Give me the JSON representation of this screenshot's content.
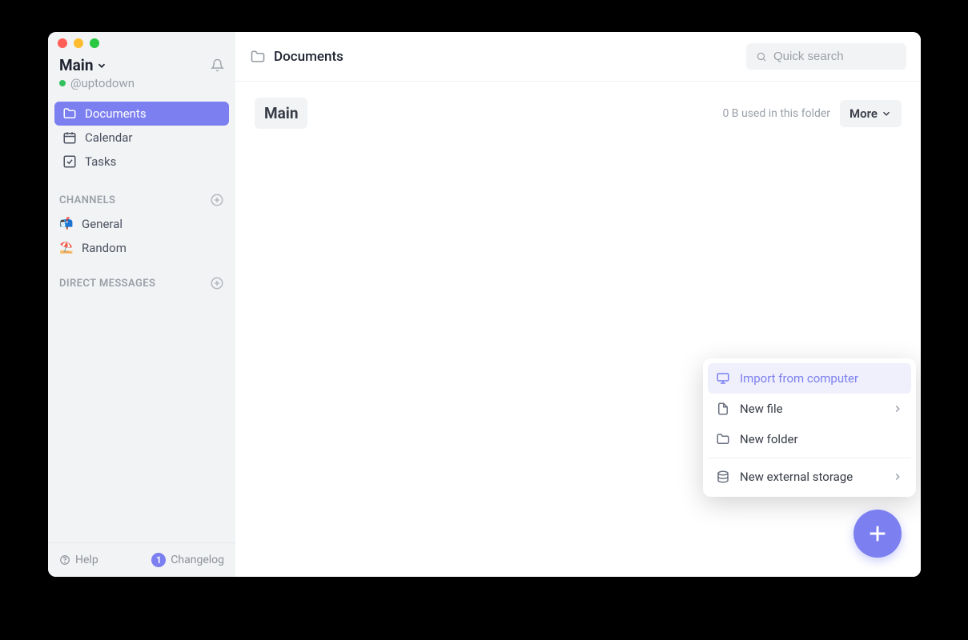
{
  "workspace": {
    "name": "Main",
    "handle": "@uptodown"
  },
  "sidebar": {
    "nav": [
      {
        "label": "Documents"
      },
      {
        "label": "Calendar"
      },
      {
        "label": "Tasks"
      }
    ],
    "channels_header": "CHANNELS",
    "channels": [
      {
        "emoji": "📬",
        "label": "General"
      },
      {
        "emoji": "⛱️",
        "label": "Random"
      }
    ],
    "dm_header": "DIRECT MESSAGES"
  },
  "footer": {
    "help": "Help",
    "changelog": "Changelog",
    "changelog_badge": "1"
  },
  "topbar": {
    "breadcrumb": "Documents",
    "search_placeholder": "Quick search"
  },
  "content": {
    "title": "Main",
    "usage": "0 B used in this folder",
    "more_label": "More"
  },
  "create_menu": {
    "items": [
      {
        "label": "Import from computer",
        "highlight": true,
        "submenu": false
      },
      {
        "label": "New file",
        "highlight": false,
        "submenu": true
      },
      {
        "label": "New folder",
        "highlight": false,
        "submenu": false
      }
    ],
    "secondary": [
      {
        "label": "New external storage",
        "submenu": true
      }
    ]
  }
}
